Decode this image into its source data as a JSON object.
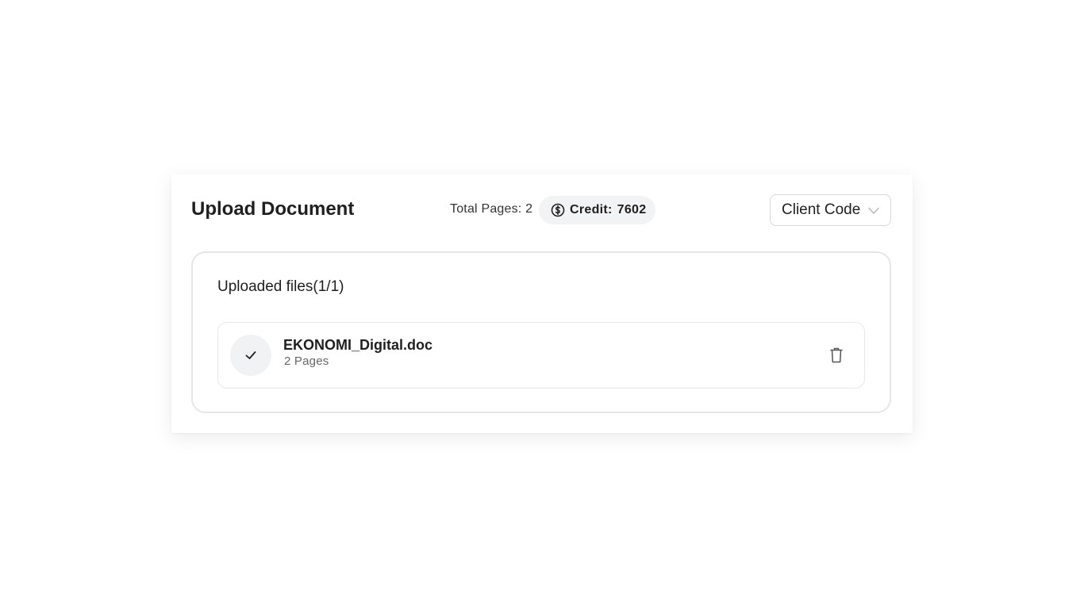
{
  "header": {
    "title": "Upload Document",
    "total_pages_label": "Total Pages:",
    "total_pages_value": "2",
    "credit_label": "Credit:",
    "credit_value": "7602",
    "credit_icon": "dollar-circle-icon",
    "client_code_placeholder": "Client Code"
  },
  "files": {
    "heading": "Uploaded files(1/1)",
    "items": [
      {
        "name": "EKONOMI_Digital.doc",
        "pages": "2 Pages",
        "status_icon": "check-icon",
        "delete_icon": "trash-icon"
      }
    ]
  },
  "colors": {
    "text": "#1f1f1f",
    "muted": "#666666",
    "pill_bg": "#f2f3f5",
    "border": "#e6e6e6"
  }
}
